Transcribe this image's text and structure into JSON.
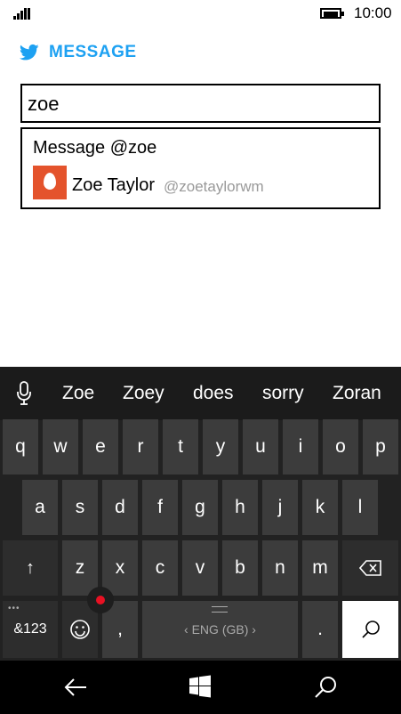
{
  "status_bar": {
    "time": "10:00",
    "signal_icon": "signal-bars-icon",
    "battery_icon": "battery-icon"
  },
  "header": {
    "title": "MESSAGE",
    "logo_icon": "twitter-bird-icon",
    "brand_color": "#1da1f2"
  },
  "search": {
    "value": "zoe"
  },
  "suggestions": {
    "message_label": "Message @zoe",
    "user": {
      "name": "Zoe Taylor",
      "handle": "@zoetaylorwm",
      "avatar_color": "#e4532c"
    }
  },
  "keyboard": {
    "predictions": [
      "Zoe",
      "Zoey",
      "does",
      "sorry",
      "Zoran"
    ],
    "row1": [
      "q",
      "w",
      "e",
      "r",
      "t",
      "y",
      "u",
      "i",
      "o",
      "p"
    ],
    "row2": [
      "a",
      "s",
      "d",
      "f",
      "g",
      "h",
      "j",
      "k",
      "l"
    ],
    "row3": [
      "z",
      "x",
      "c",
      "v",
      "b",
      "n",
      "m"
    ],
    "shift_label": "↑",
    "numbers_label": "&123",
    "comma_label": ",",
    "space_label": "‹ ENG (GB) ›",
    "period_label": ".",
    "dots_label": "•••",
    "backspace_icon": "backspace-icon",
    "emoji_icon": "emoji-icon",
    "search_icon": "search-icon",
    "mic_icon": "microphone-icon"
  },
  "nav": {
    "back_icon": "back-arrow-icon",
    "home_icon": "windows-logo-icon",
    "search_icon": "search-icon"
  }
}
